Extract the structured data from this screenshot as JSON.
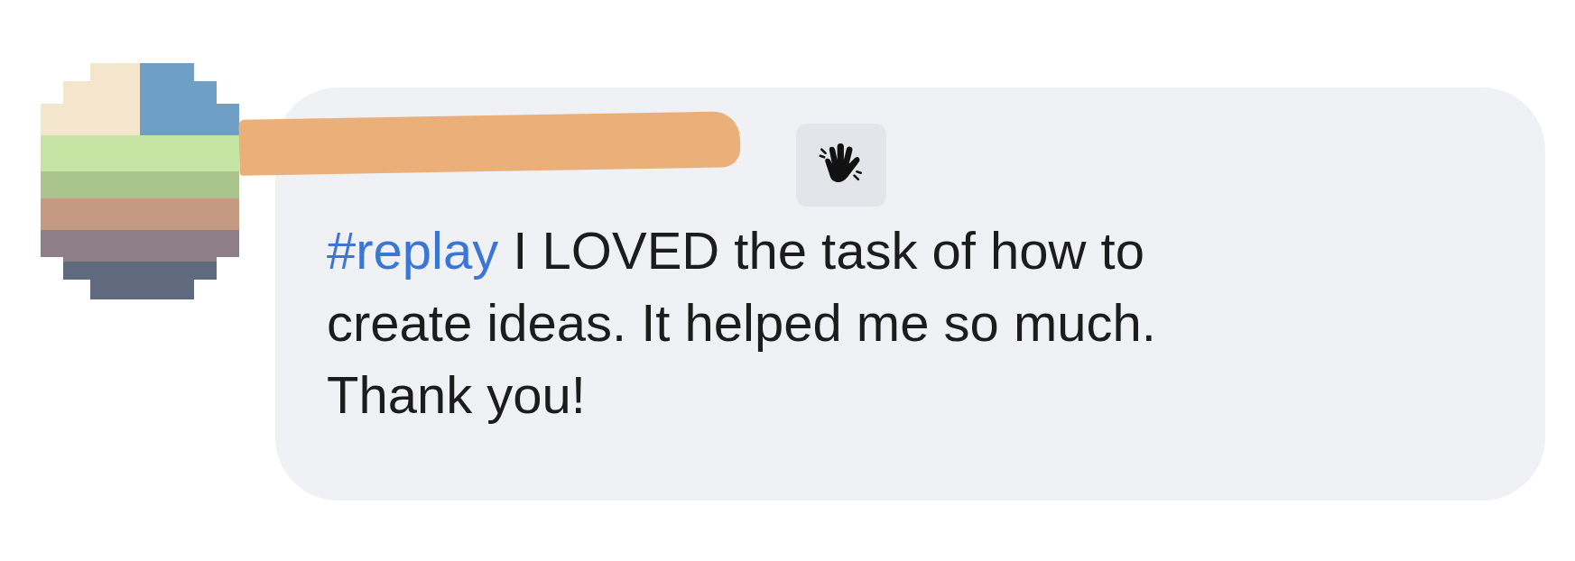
{
  "comment": {
    "name_redacted": true,
    "badge": {
      "kind": "wave"
    },
    "hashtag": "#replay",
    "text": "I LOVED the task of how to create ideas. It helped me so much. Thank you!"
  }
}
